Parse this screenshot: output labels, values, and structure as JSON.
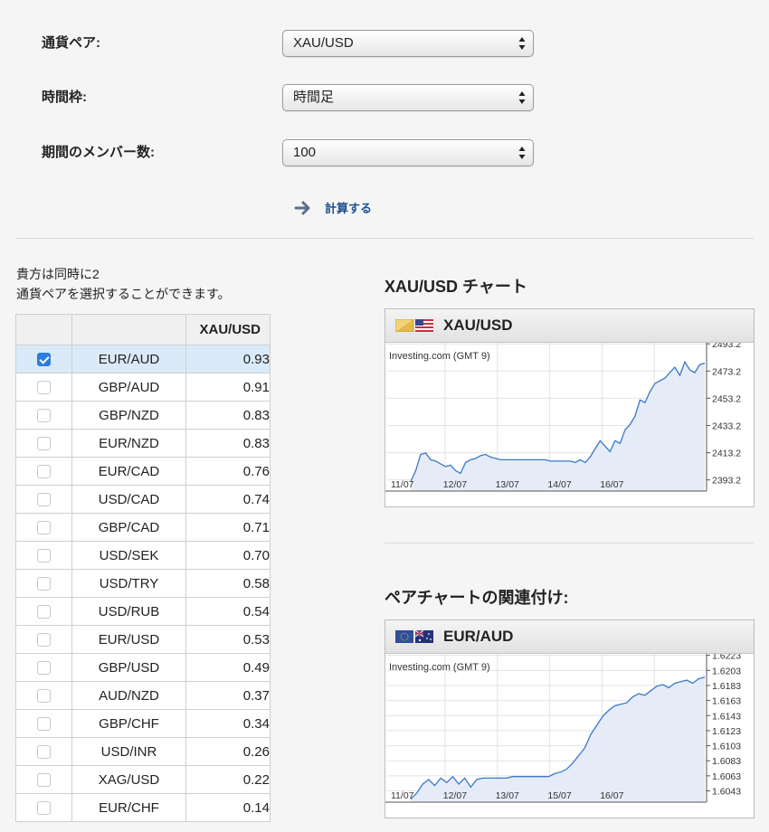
{
  "form": {
    "pair_label": "通貨ペア:",
    "pair_value": "XAU/USD",
    "timeframe_label": "時間枠:",
    "timeframe_value": "時間足",
    "members_label": "期間のメンバー数:",
    "members_value": "100",
    "calculate_label": "計算する"
  },
  "note": {
    "line1": "貴方は同時に2",
    "line2": "通貨ペアを選択することができます。"
  },
  "table": {
    "header": "XAU/USD",
    "rows": [
      {
        "pair": "EUR/AUD",
        "value": "0.93",
        "checked": true
      },
      {
        "pair": "GBP/AUD",
        "value": "0.91",
        "checked": false
      },
      {
        "pair": "GBP/NZD",
        "value": "0.83",
        "checked": false
      },
      {
        "pair": "EUR/NZD",
        "value": "0.83",
        "checked": false
      },
      {
        "pair": "EUR/CAD",
        "value": "0.76",
        "checked": false
      },
      {
        "pair": "USD/CAD",
        "value": "0.74",
        "checked": false
      },
      {
        "pair": "GBP/CAD",
        "value": "0.71",
        "checked": false
      },
      {
        "pair": "USD/SEK",
        "value": "0.70",
        "checked": false
      },
      {
        "pair": "USD/TRY",
        "value": "0.58",
        "checked": false
      },
      {
        "pair": "USD/RUB",
        "value": "0.54",
        "checked": false
      },
      {
        "pair": "EUR/USD",
        "value": "0.53",
        "checked": false
      },
      {
        "pair": "GBP/USD",
        "value": "0.49",
        "checked": false
      },
      {
        "pair": "AUD/NZD",
        "value": "0.37",
        "checked": false
      },
      {
        "pair": "GBP/CHF",
        "value": "0.34",
        "checked": false
      },
      {
        "pair": "USD/INR",
        "value": "0.26",
        "checked": false
      },
      {
        "pair": "XAG/USD",
        "value": "0.22",
        "checked": false
      },
      {
        "pair": "EUR/CHF",
        "value": "0.14",
        "checked": false
      }
    ]
  },
  "chart1": {
    "section_title": "XAU/USD チャート",
    "pair": "XAU/USD",
    "flags": [
      "gold-flag-icon",
      "us-flag-icon"
    ],
    "source": "Investing.com (GMT 9)"
  },
  "chart2": {
    "section_title": "ペアチャートの関連付け:",
    "pair": "EUR/AUD",
    "flags": [
      "eu-flag-icon",
      "au-flag-icon"
    ],
    "source": "Investing.com (GMT 9)"
  },
  "chart_data": [
    {
      "type": "area",
      "series": [
        {
          "values": [
            2392,
            2400,
            2412,
            2413,
            2408,
            2407,
            2405,
            2403,
            2404,
            2400,
            2398,
            2406,
            2408,
            2409,
            2411,
            2412,
            2410,
            2409,
            2408,
            2408,
            2408,
            2408,
            2408,
            2408,
            2408,
            2408,
            2408,
            2408,
            2407,
            2407,
            2407,
            2407,
            2407,
            2406,
            2408,
            2406,
            2410,
            2416,
            2422,
            2418,
            2414,
            2422,
            2420,
            2430,
            2434,
            2440,
            2452,
            2450,
            2458,
            2464,
            2466,
            2468,
            2472,
            2476,
            2470,
            2480,
            2474,
            2472,
            2478,
            2479
          ]
        }
      ],
      "xlabels": [
        "11/07",
        "12/07",
        "13/07",
        "14/07",
        "16/07"
      ],
      "ylabels": [
        "2493.2",
        "2473.2",
        "2453.2",
        "2433.2",
        "2413.2",
        "2393.2"
      ],
      "ylim": [
        2385,
        2494
      ]
    },
    {
      "type": "area",
      "series": [
        {
          "values": [
            1.6032,
            1.604,
            1.6052,
            1.6058,
            1.605,
            1.606,
            1.6054,
            1.6062,
            1.6052,
            1.606,
            1.6048,
            1.6058,
            1.606,
            1.606,
            1.606,
            1.606,
            1.606,
            1.6062,
            1.6062,
            1.6062,
            1.6062,
            1.6062,
            1.6062,
            1.6062,
            1.6066,
            1.6068,
            1.6072,
            1.608,
            1.609,
            1.61,
            1.6118,
            1.613,
            1.6142,
            1.615,
            1.6156,
            1.6158,
            1.616,
            1.6168,
            1.6172,
            1.617,
            1.6176,
            1.6182,
            1.6184,
            1.618,
            1.6186,
            1.6188,
            1.619,
            1.6186,
            1.6192,
            1.6194
          ]
        }
      ],
      "xlabels": [
        "11/07",
        "12/07",
        "13/07",
        "15/07",
        "16/07"
      ],
      "ylabels": [
        "1.6223",
        "1.6203",
        "1.6183",
        "1.6163",
        "1.6143",
        "1.6123",
        "1.6103",
        "1.6083",
        "1.6063",
        "1.6043"
      ],
      "ylim": [
        1.6028,
        1.6225
      ]
    }
  ],
  "colors": {
    "accent": "#1d4f91",
    "line": "#3a78c9",
    "area": "#e6ecf7",
    "selected_row": "#dbeaf8"
  }
}
